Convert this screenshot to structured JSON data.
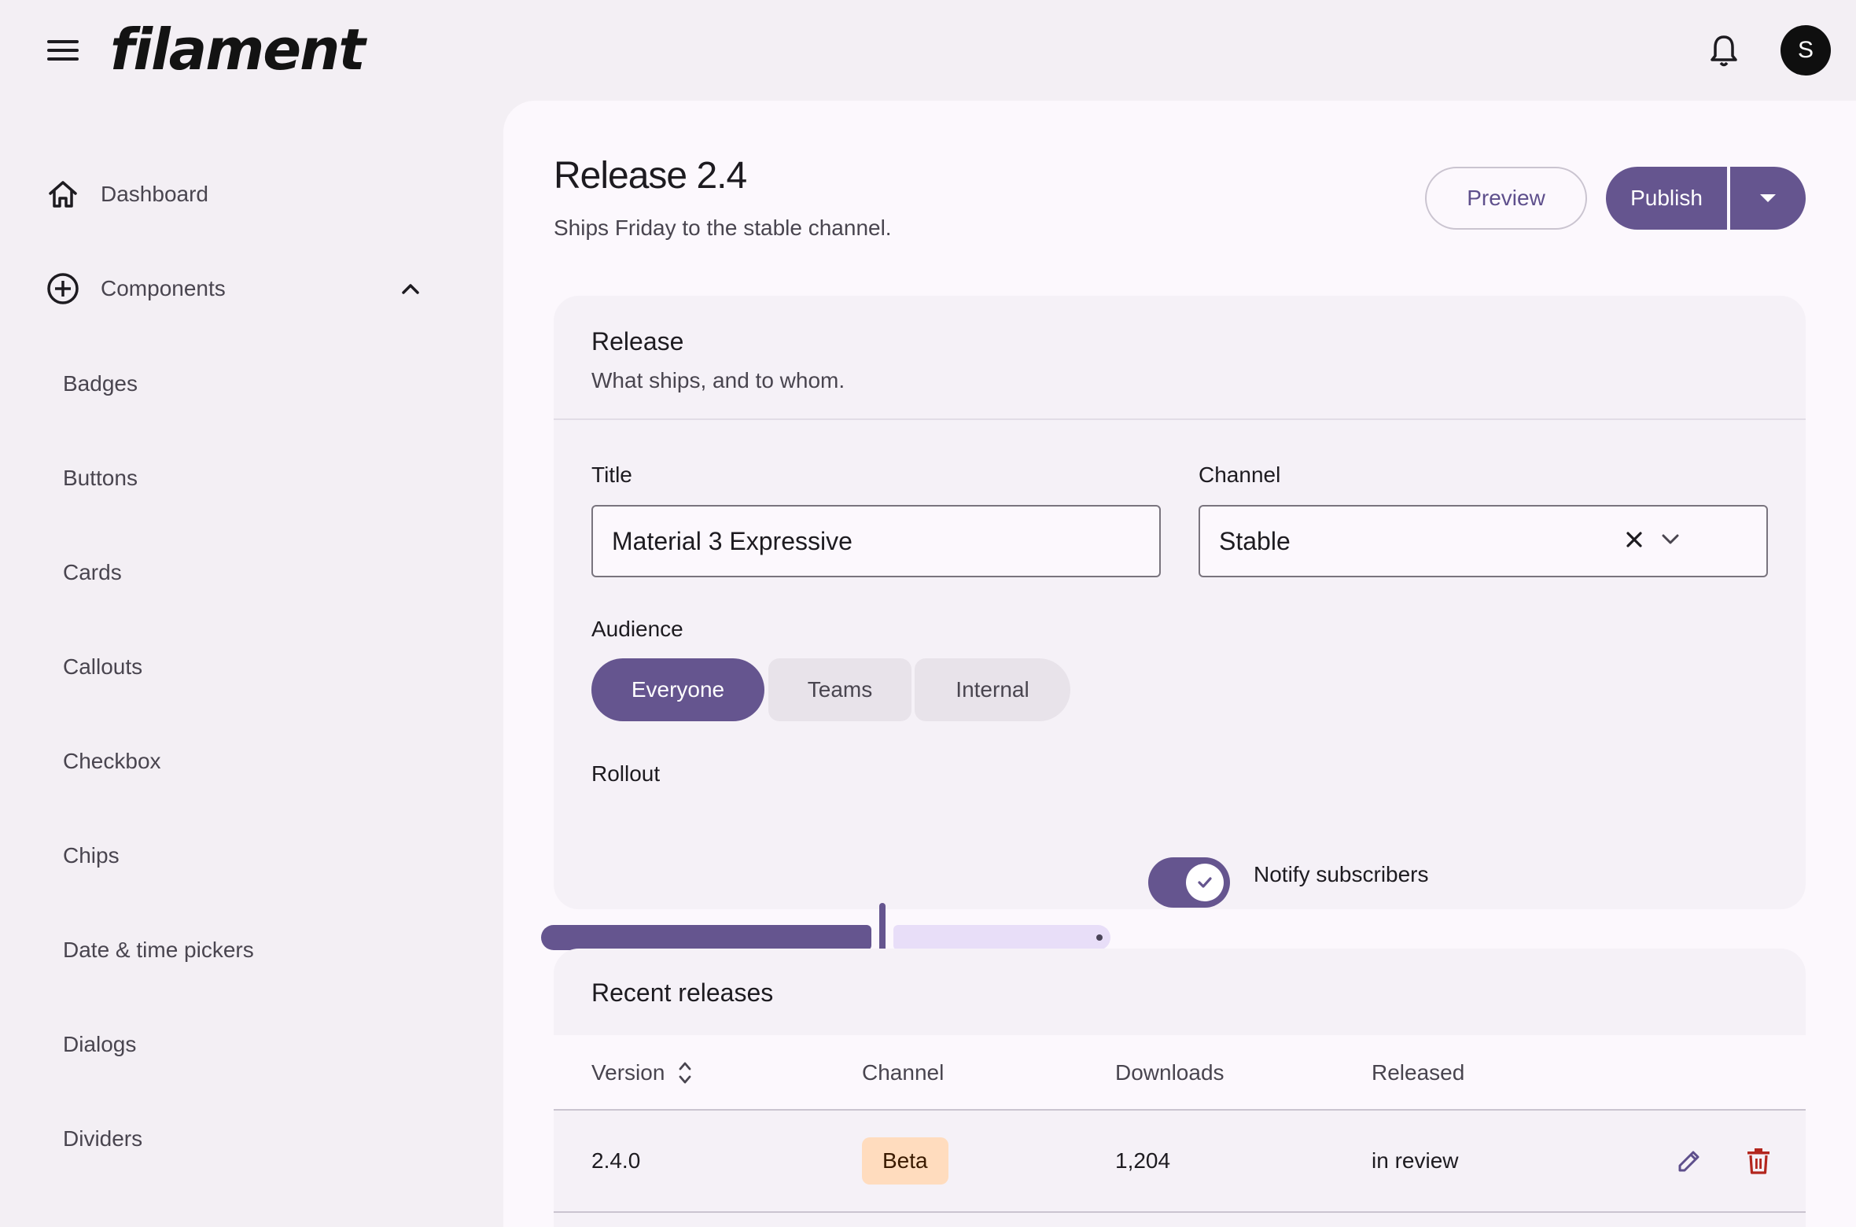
{
  "app": {
    "logo_text": "filament",
    "avatar_initial": "S"
  },
  "sidebar": {
    "items": [
      {
        "label": "Dashboard",
        "icon": "home-icon"
      },
      {
        "label": "Components",
        "icon": "add-circle-icon",
        "expanded": true
      }
    ],
    "sub_items": [
      "Badges",
      "Buttons",
      "Cards",
      "Callouts",
      "Checkbox",
      "Chips",
      "Date & time pickers",
      "Dialogs",
      "Dividers"
    ]
  },
  "header": {
    "title": "Release 2.4",
    "subtitle": "Ships Friday to the stable channel.",
    "preview_label": "Preview",
    "publish_label": "Publish"
  },
  "release_card": {
    "title": "Release",
    "subtitle": "What ships, and to whom.",
    "title_field": {
      "label": "Title",
      "value": "Material 3 Expressive"
    },
    "channel_field": {
      "label": "Channel",
      "value": "Stable"
    },
    "audience": {
      "label": "Audience",
      "options": [
        "Everyone",
        "Teams",
        "Internal"
      ],
      "selected": "Everyone"
    },
    "rollout": {
      "label": "Rollout",
      "value_fraction": 0.6
    },
    "notify": {
      "label": "Notify subscribers",
      "checked": true
    }
  },
  "recent": {
    "title": "Recent releases",
    "columns": [
      "Version",
      "Channel",
      "Downloads",
      "Released"
    ],
    "rows": [
      {
        "version": "2.4.0",
        "channel": "Beta",
        "downloads": "1,204",
        "released": "in review"
      }
    ]
  },
  "colors": {
    "primary": "#65558f",
    "surface": "#fcf8fd",
    "background": "#f3eff4",
    "beta_badge": "#ffdcbe",
    "delete": "#b3261e"
  }
}
